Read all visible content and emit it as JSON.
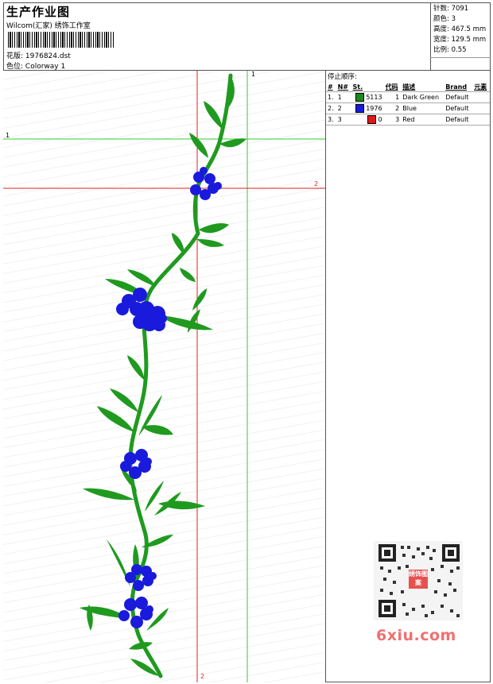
{
  "header": {
    "title": "生产作业图",
    "subtitle": "Wilcom(汇家) 绣饰工作室",
    "design_label": "花版:",
    "design_value": "1976824.dst",
    "colorway_label": "色位:",
    "colorway_value": "Colorway 1"
  },
  "stats": {
    "stitches_label": "针数:",
    "stitches_value": "7091",
    "colors_label": "颜色:",
    "colors_value": "3",
    "height_label": "高度:",
    "height_value": "467.5 mm",
    "width_label": "宽度:",
    "width_value": "129.5 mm",
    "scale_label": "比例:",
    "scale_value": "0.55"
  },
  "thread_table": {
    "stop_sequence_label": "停止顺序:",
    "columns": [
      "#",
      "N#",
      "St.",
      "代码",
      "描述",
      "Brand",
      "元素"
    ],
    "rows": [
      {
        "idx": "1.",
        "n": "1",
        "color": "#1a8a1a",
        "st": "5113",
        "code": "1",
        "desc": "Dark Green",
        "brand": "Default"
      },
      {
        "idx": "2.",
        "n": "2",
        "color": "#1a1adc",
        "st": "1976",
        "code": "2",
        "desc": "Blue",
        "brand": "Default"
      },
      {
        "idx": "3.",
        "n": "3",
        "color": "#e01818",
        "st": "0",
        "code": "3",
        "desc": "Red",
        "brand": "Default"
      }
    ]
  },
  "guides": {
    "green_v_label": "1",
    "green_h_label": "1",
    "red_h_label": "2",
    "red_v_label": "2",
    "green_color": "#33cc33",
    "red_color": "#e02020"
  },
  "watermark": {
    "text": "6xiu.com",
    "seal_text": "绣饰图案"
  }
}
